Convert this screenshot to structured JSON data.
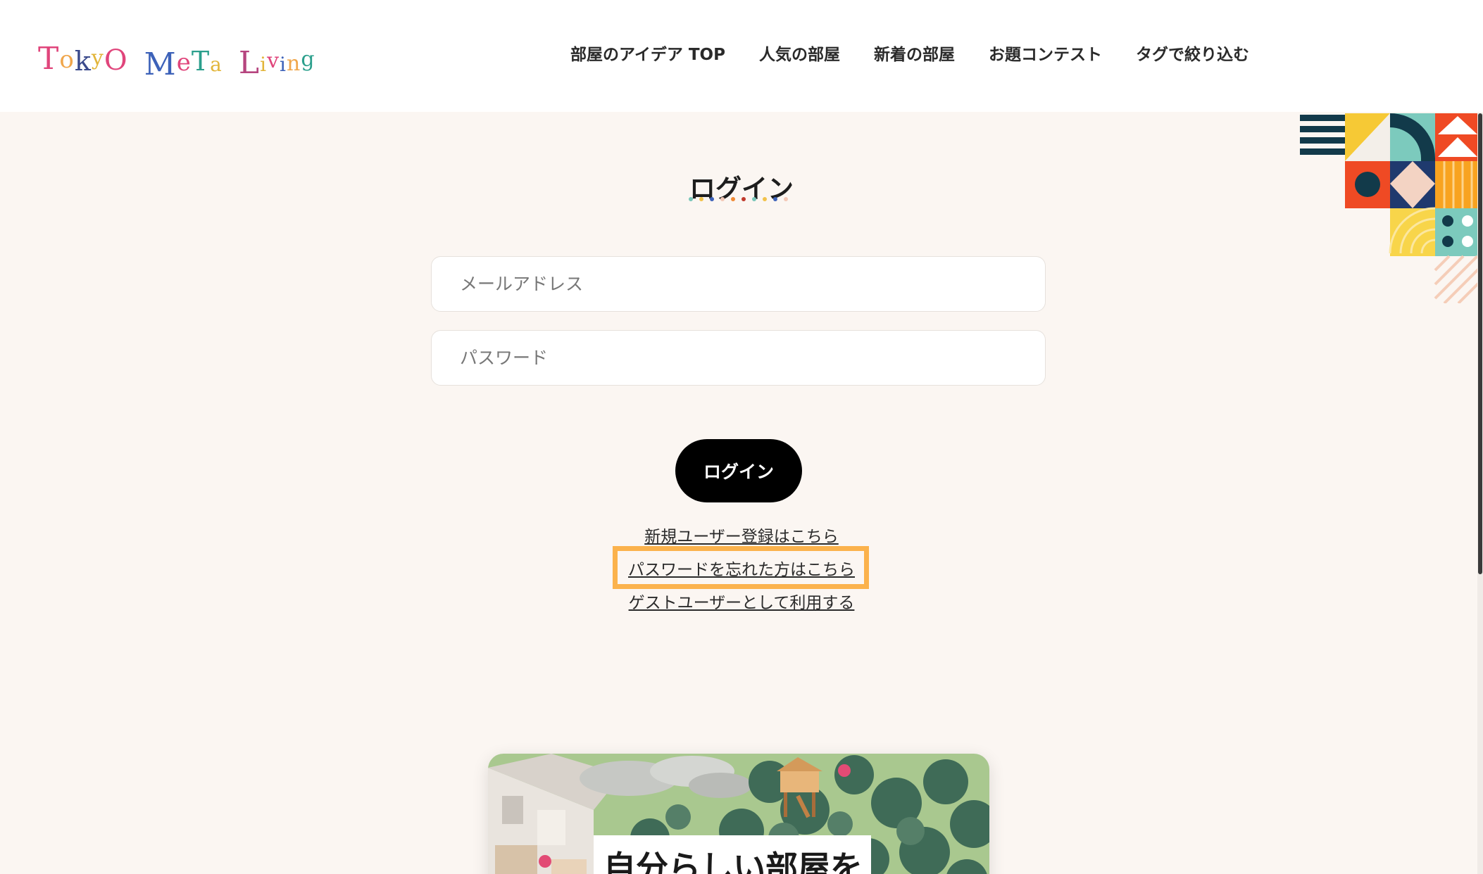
{
  "logo": {
    "text": "TokyO MeTa Living",
    "letters": [
      {
        "ch": "T",
        "color": "#e0457b"
      },
      {
        "ch": "o",
        "color": "#f0a64b"
      },
      {
        "ch": "k",
        "color": "#3b4a8c"
      },
      {
        "ch": "y",
        "color": "#e2b53a"
      },
      {
        "ch": "O",
        "color": "#e0457b"
      },
      {
        "ch": " ",
        "color": "#000000"
      },
      {
        "ch": "M",
        "color": "#3d62b9"
      },
      {
        "ch": "e",
        "color": "#e0457b"
      },
      {
        "ch": "T",
        "color": "#2b9f8c"
      },
      {
        "ch": "a",
        "color": "#e2b53a"
      },
      {
        "ch": " ",
        "color": "#000000"
      },
      {
        "ch": "L",
        "color": "#b6457f"
      },
      {
        "ch": "i",
        "color": "#e2b53a"
      },
      {
        "ch": "v",
        "color": "#e0457b"
      },
      {
        "ch": "i",
        "color": "#3d62b9"
      },
      {
        "ch": "n",
        "color": "#f0a64b"
      },
      {
        "ch": "g",
        "color": "#2b9f8c"
      }
    ]
  },
  "nav": {
    "items": [
      {
        "label": "部屋のアイデア TOP"
      },
      {
        "label": "人気の部屋"
      },
      {
        "label": "新着の部屋"
      },
      {
        "label": "お題コンテスト"
      },
      {
        "label": "タグで絞り込む"
      }
    ]
  },
  "login": {
    "title": "ログイン",
    "email_placeholder": "メールアドレス",
    "email_value": "",
    "password_placeholder": "パスワード",
    "password_value": "",
    "button_label": "ログイン",
    "register_link": "新規ユーザー登録はこちら",
    "forgot_link": "パスワードを忘れた方はこちら",
    "guest_link": "ゲストユーザーとして利用する"
  },
  "title_dots": [
    "#78c6b9",
    "#f2c24a",
    "#3d62b9",
    "#f3c8b6",
    "#f08a35",
    "#c0392b",
    "#78c6b9",
    "#f2c24a",
    "#3d62b9",
    "#f3c8b6"
  ],
  "banner": {
    "text": "自分らしい部屋を"
  },
  "colors": {
    "background": "#fbf6f2",
    "highlight": "#fbb24c",
    "button": "#000000"
  }
}
